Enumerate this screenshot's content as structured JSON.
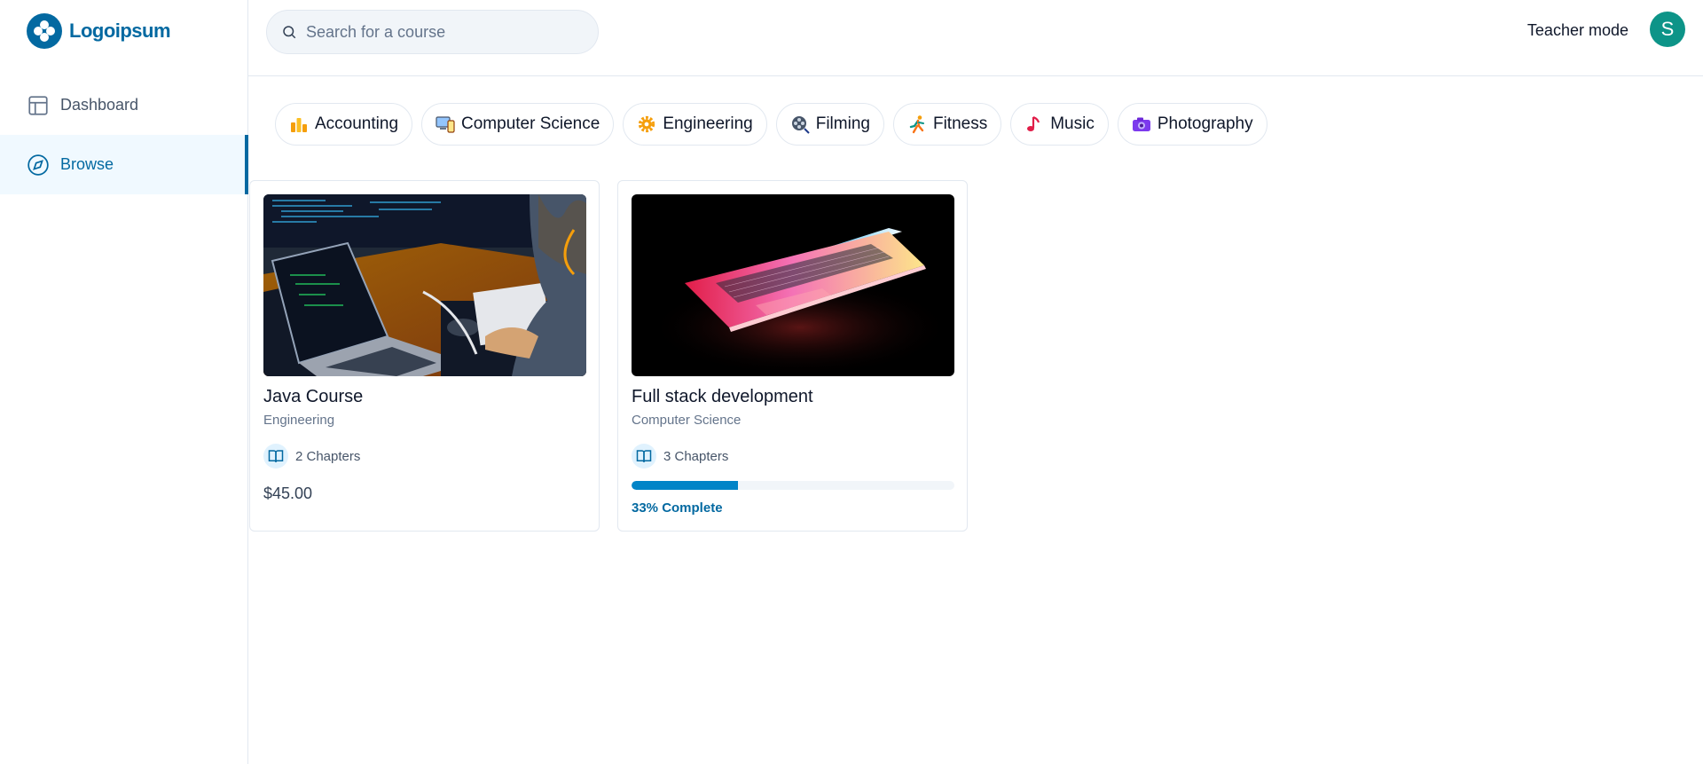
{
  "brand": {
    "name": "Logoipsum",
    "color": "#0369a1"
  },
  "sidebar": {
    "items": [
      {
        "label": "Dashboard",
        "icon": "layout-icon",
        "active": false
      },
      {
        "label": "Browse",
        "icon": "compass-icon",
        "active": true
      }
    ]
  },
  "header": {
    "search": {
      "placeholder": "Search for a course",
      "value": ""
    },
    "teacher_mode_label": "Teacher mode",
    "avatar_initial": "S"
  },
  "categories": [
    {
      "label": "Accounting",
      "icon": "bar-chart-icon"
    },
    {
      "label": "Computer Science",
      "icon": "computer-icon"
    },
    {
      "label": "Engineering",
      "icon": "gear-icon"
    },
    {
      "label": "Filming",
      "icon": "film-reel-icon"
    },
    {
      "label": "Fitness",
      "icon": "runner-icon"
    },
    {
      "label": "Music",
      "icon": "music-note-icon"
    },
    {
      "label": "Photography",
      "icon": "camera-icon"
    }
  ],
  "courses": [
    {
      "title": "Java Course",
      "category": "Engineering",
      "chapters": "2 Chapters",
      "price": "$45.00",
      "image": "developer-laptop-photo"
    },
    {
      "title": "Full stack development",
      "category": "Computer Science",
      "chapters": "3 Chapters",
      "progress": 0.33,
      "progress_label": "33% Complete",
      "image": "glowing-laptop-photo"
    }
  ]
}
